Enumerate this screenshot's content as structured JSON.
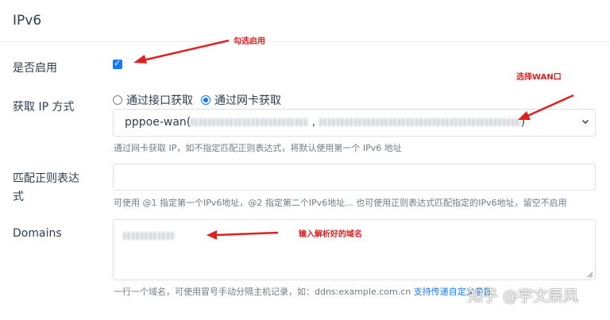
{
  "section": {
    "title": "IPv6"
  },
  "enable": {
    "label": "是否启用",
    "checked": true
  },
  "ip_method": {
    "label": "获取 IP 方式",
    "options": [
      {
        "label": "通过接口获取",
        "checked": false
      },
      {
        "label": "通过网卡获取",
        "checked": true
      }
    ],
    "select_prefix": "pppoe-wan(",
    "select_suffix": ")",
    "hint": "通过网卡获取 IP，如不指定匹配正则表达式，将默认使用第一个 IPv6 地址"
  },
  "regex": {
    "label_line1": "匹配正则表达",
    "label_line2": "式",
    "value": "",
    "hint": "可使用 @1 指定第一个IPv6地址，@2 指定第二个IPv6地址... 也可使用正则表达式匹配指定的IPv6地址，留空不启用"
  },
  "domains": {
    "label": "Domains",
    "hint": "一行一个域名，可使用冒号手动分隔主机记录，如：ddns:example.com.cn",
    "hint_link": "支持传递自定义参数"
  },
  "annotations": {
    "check_enable": "勾选启用",
    "choose_wan": "选择WAN口",
    "enter_domain": "输入解析好的域名"
  },
  "watermark": "知乎 @宇文辰风",
  "colors": {
    "accent": "#1677ff",
    "annotation": "#e02020",
    "hint": "#727b86"
  }
}
